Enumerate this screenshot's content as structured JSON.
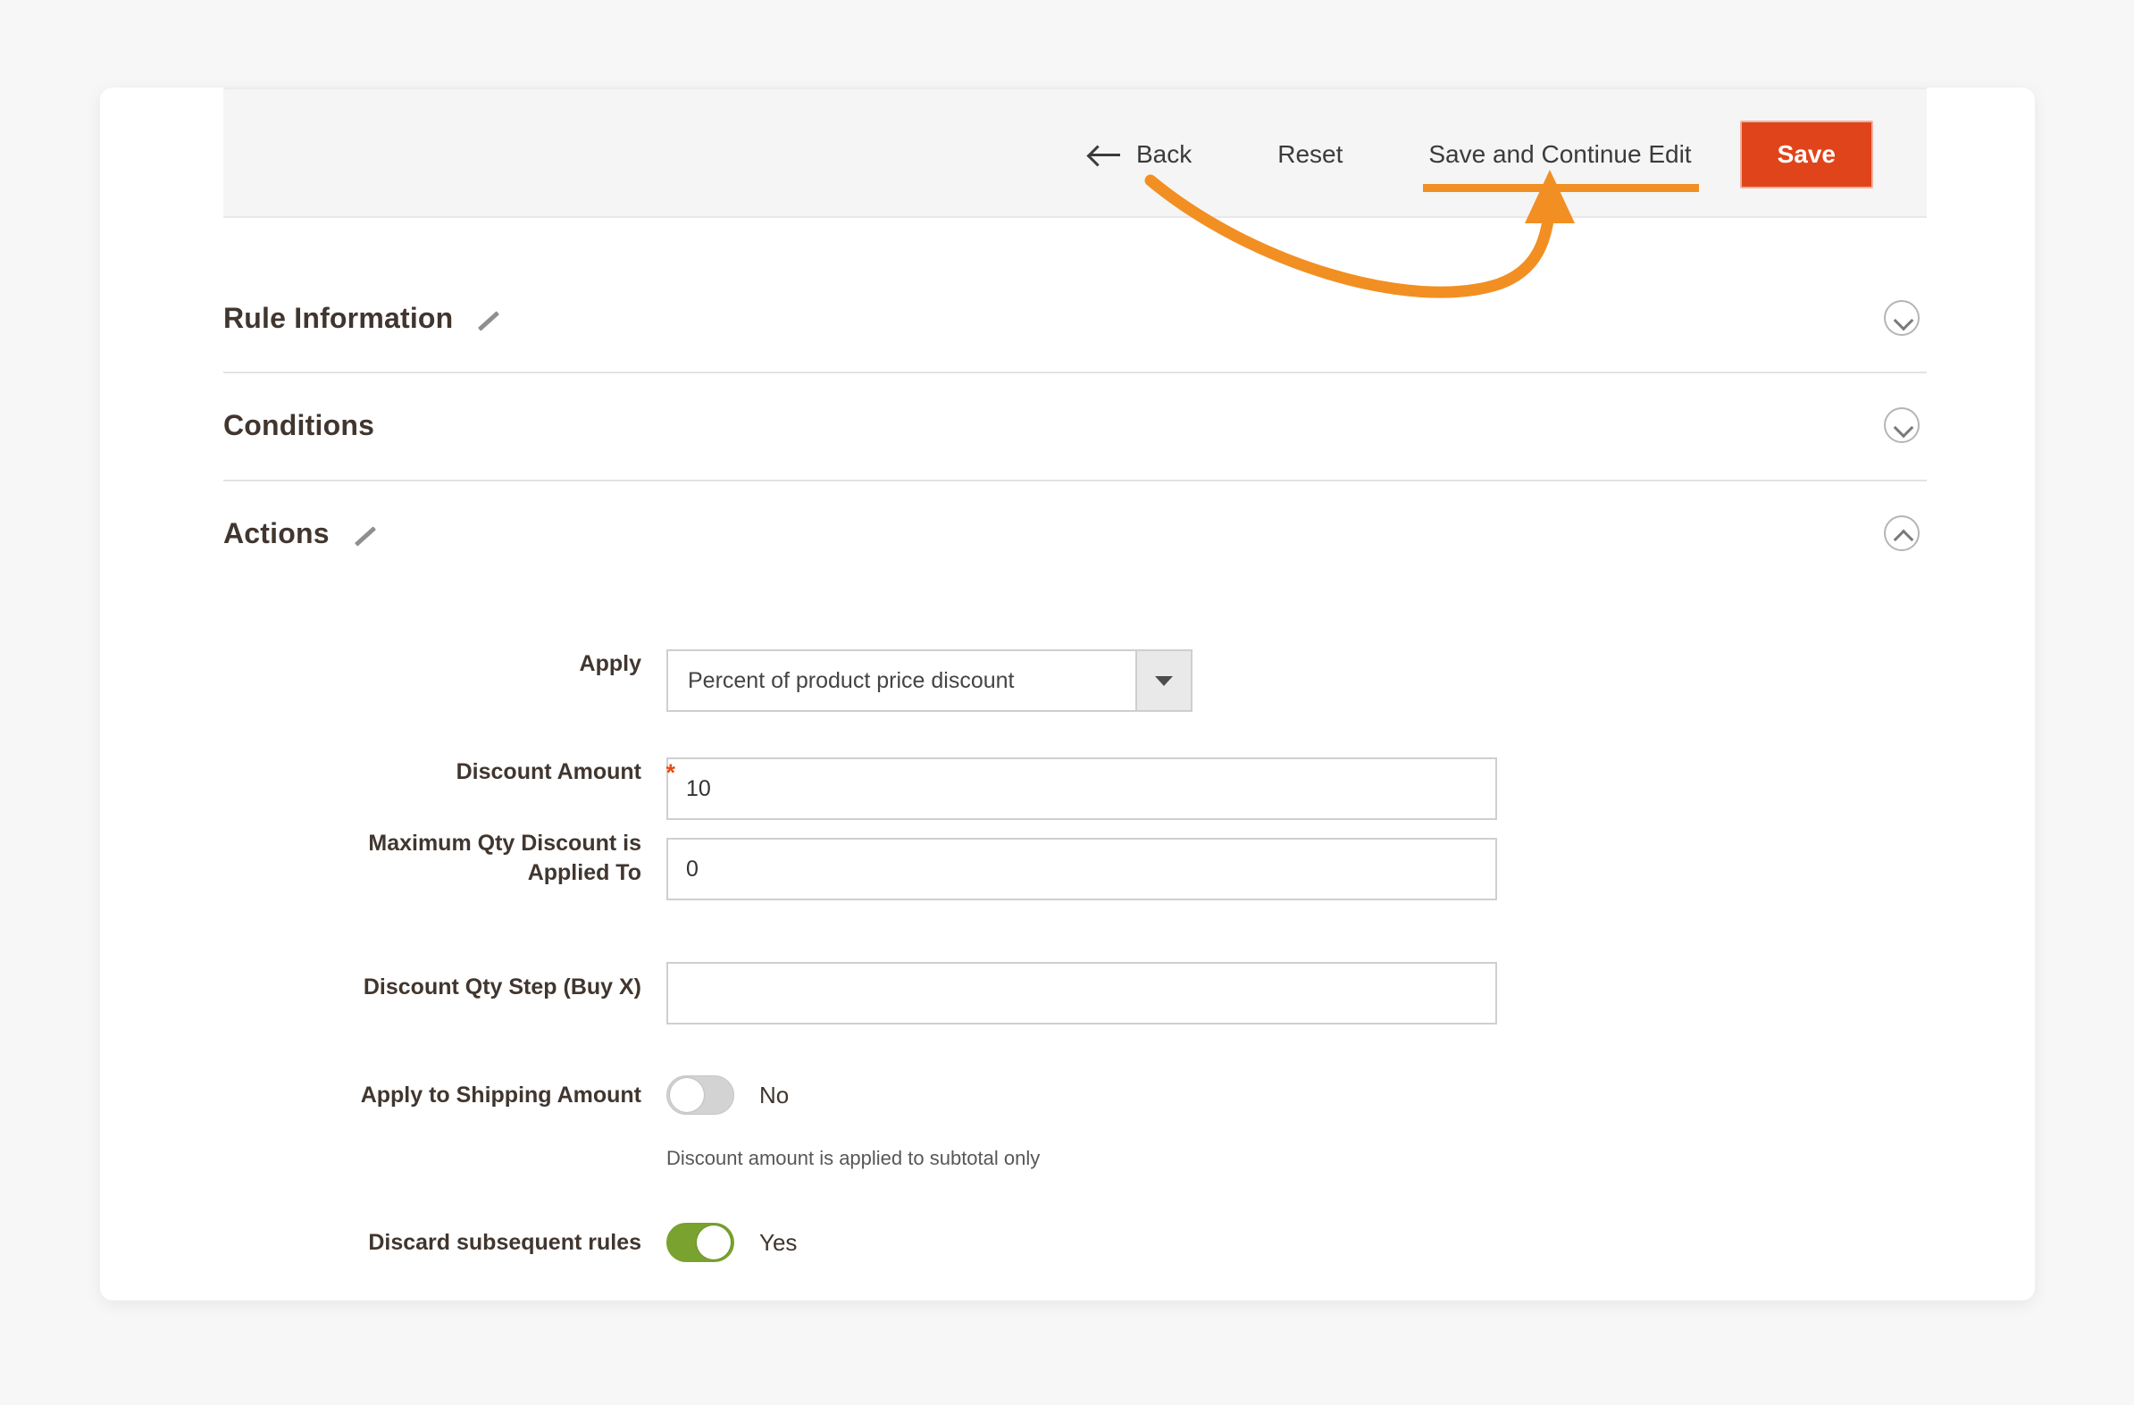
{
  "toolbar": {
    "back_label": "Back",
    "back_icon": "arrow-left-icon",
    "reset_label": "Reset",
    "save_continue_label": "Save and Continue Edit",
    "save_label": "Save",
    "save_button_color": "#e0441a",
    "highlight_color": "#f28f22"
  },
  "annotation": {
    "type": "curved-arrow",
    "color": "#f28f22",
    "points_to": "Save and Continue Edit"
  },
  "sections": [
    {
      "title": "Rule Information",
      "has_pencil": true,
      "expanded": false,
      "chevron": "chevron-down-icon"
    },
    {
      "title": "Conditions",
      "has_pencil": false,
      "expanded": false,
      "chevron": "chevron-down-icon"
    },
    {
      "title": "Actions",
      "has_pencil": true,
      "expanded": true,
      "chevron": "chevron-up-icon"
    }
  ],
  "actions_form": {
    "apply": {
      "label": "Apply",
      "selected": "Percent of product price discount"
    },
    "discount_amount": {
      "label": "Discount Amount",
      "required": true,
      "required_marker": "*",
      "value": "10"
    },
    "maximum_qty": {
      "label_line1": "Maximum Qty Discount is",
      "label_line2": "Applied To",
      "value": "0"
    },
    "discount_qty_step": {
      "label": "Discount Qty Step (Buy X)",
      "value": ""
    },
    "apply_to_shipping": {
      "label": "Apply to Shipping Amount",
      "state_label": "No",
      "on": false,
      "helper": "Discount amount is applied to subtotal only"
    },
    "discard_subsequent": {
      "label": "Discard subsequent rules",
      "state_label": "Yes",
      "on": true,
      "on_color": "#79a22e"
    }
  }
}
